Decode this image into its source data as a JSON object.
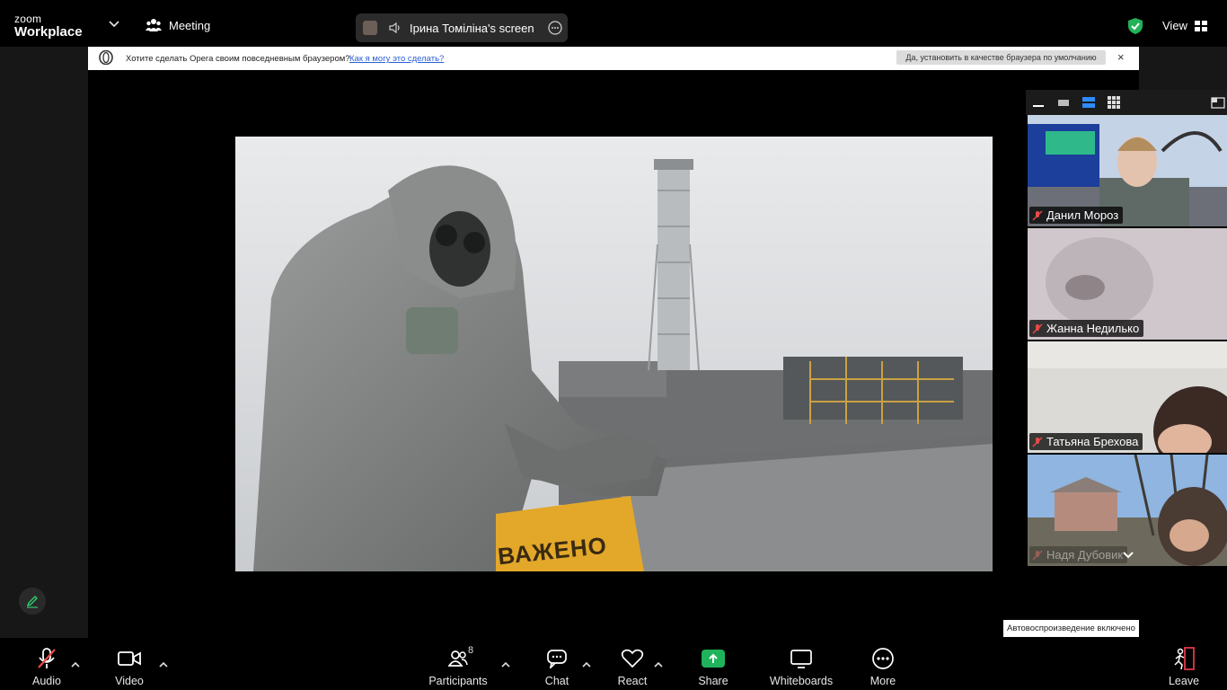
{
  "app": {
    "logo_line1": "zoom",
    "logo_line2": "Workplace"
  },
  "header": {
    "meeting_label": "Meeting",
    "share_owner": "Ірина  Томіліна's screen",
    "view_label": "View",
    "security_color": "#23b25a"
  },
  "opera_bar": {
    "question": "Хотите сделать Opera своим повседневным браузером?",
    "link": "Как я могу это сделать?",
    "button": "Да, установить в качестве браузера по умолчанию",
    "close": "×"
  },
  "participants_panel": {
    "tiles": [
      {
        "name": "Данил Мороз",
        "muted": true
      },
      {
        "name": "Жанна Недилько",
        "muted": true
      },
      {
        "name": "Татьяна Брехова",
        "muted": true
      },
      {
        "name": "Надя Дубовик",
        "muted": true
      }
    ]
  },
  "notice": {
    "autoplay": "Автовоспроизведение включено"
  },
  "toolbar": {
    "audio": "Audio",
    "video": "Video",
    "participants": "Participants",
    "participants_count": "8",
    "chat": "Chat",
    "react": "React",
    "share": "Share",
    "whiteboards": "Whiteboards",
    "more": "More",
    "leave": "Leave",
    "share_color": "#1fb35b",
    "leave_color": "#e0384a"
  },
  "shared_content": {
    "sign_text": "ВАЖЕНО"
  }
}
